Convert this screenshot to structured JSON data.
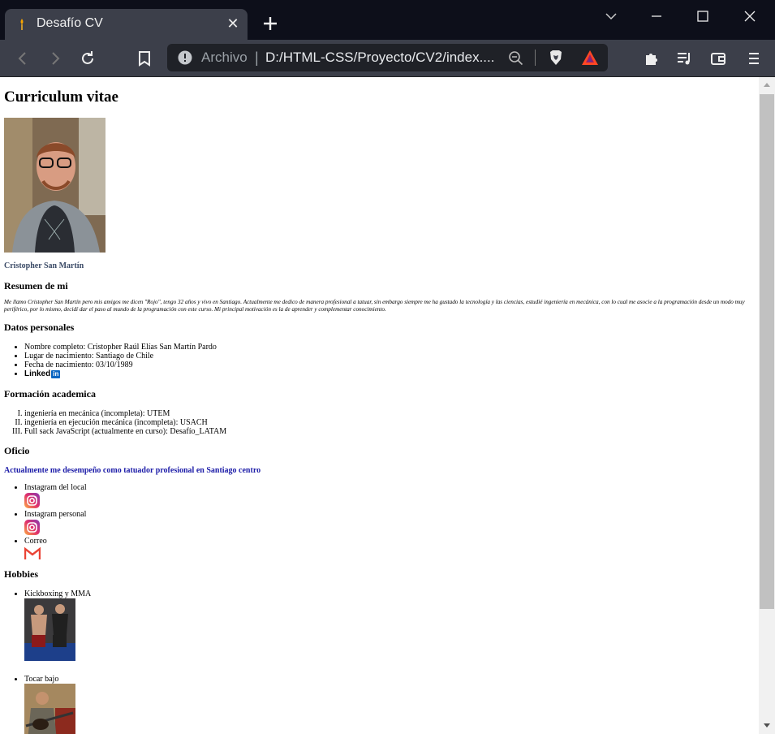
{
  "browser": {
    "tab_title": "Desafío CV",
    "omnibox_scheme": "Archivo",
    "omnibox_separator": "|",
    "omnibox_url": "D:/HTML-CSS/Proyecto/CV2/index....",
    "tab_close_glyph": "✕"
  },
  "icons": {
    "favicon": "torch-icon",
    "back": "back-arrow-icon",
    "forward": "forward-arrow-icon",
    "reload": "reload-icon",
    "bookmark": "bookmark-icon",
    "info": "info-icon",
    "zoom": "zoom-out-icon",
    "brave": "brave-shield-icon",
    "bat": "bat-rewards-icon",
    "extensions": "puzzle-icon",
    "media": "playlist-icon",
    "wallet": "wallet-icon",
    "menu": "hamburger-menu-icon"
  },
  "page": {
    "heading": "Curriculum vitae",
    "name": "Cristopher San Martín",
    "sections": {
      "about": "Resumen de mi",
      "personal": "Datos personales",
      "education": "Formación academica",
      "job": "Oficio",
      "hobbies": "Hobbies"
    },
    "about_text": "Me llamo Cristopher San Martín pero mis amigos me dicen \"Rojo\", tengo 32 años y vivo en Santiago. Actualmente me dedico de manera profesional a tatuar, sin embargo siempre me ha gustado la tecnología y las ciencias, estudié ingeniería en mecánica, con lo cual me asocie a la programación desde un modo muy periférico, por lo mismo, decidí dar el paso al mundo de la programación con este curso. Mi principal motivación es la de aprender y complementar conocimiento.",
    "personal": [
      "Nombre completo: Cristopher Raúl Elías San Martín Pardo",
      "Lugar de nacimiento: Santiago de Chile",
      "Fecha de nacimiento: 03/10/1989"
    ],
    "linkedin_text": "Linked",
    "linkedin_badge": "in",
    "education": [
      "ingeniería en mecánica (incompleta): UTEM",
      "ingeniería en ejecución mecánica (incompleta): USACH",
      "Full sack JavaScript (actualmente en curso): Desafío_LATAM"
    ],
    "job_text": "Actualmente me desempeño como tatuador profesional en Santiago centro",
    "social": [
      "Instagram del local",
      "Instagram personal",
      "Correo"
    ],
    "hobbies": [
      "Kickboxing y MMA",
      "Tocar bajo"
    ]
  },
  "colors": {
    "tab_strip": "#0d0f1a",
    "toolbar": "#3c3f4a",
    "name_color": "#3a4a66",
    "job_link": "#1c1ca8"
  }
}
